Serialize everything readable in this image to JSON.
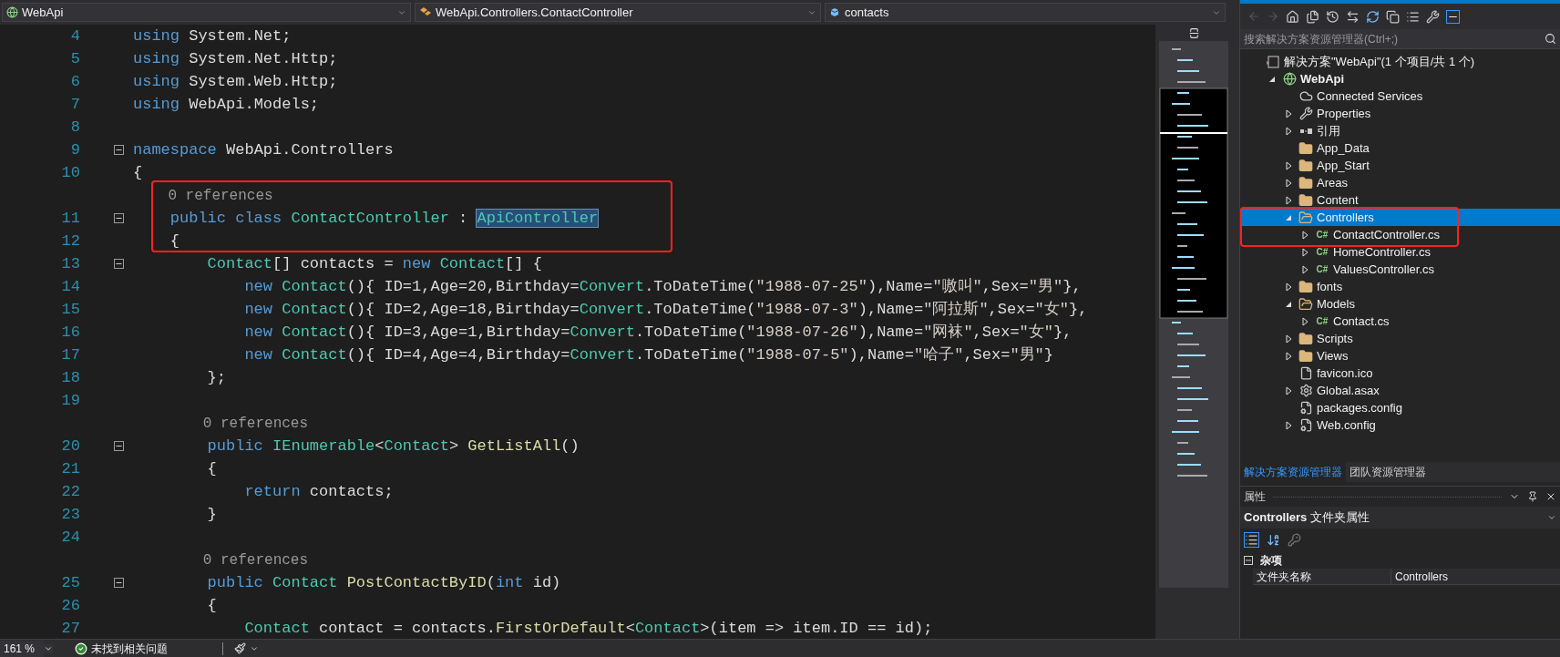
{
  "navbar": {
    "project": "WebApi",
    "type": "WebApi.Controllers.ContactController",
    "member": "contacts"
  },
  "code": [
    {
      "kind": "code",
      "number": "4",
      "fold": false,
      "tokens": [
        {
          "kind": "keyword",
          "text": "using"
        },
        {
          "kind": "plain",
          "text": " System.Net;"
        }
      ]
    },
    {
      "kind": "code",
      "number": "5",
      "fold": false,
      "tokens": [
        {
          "kind": "keyword",
          "text": "using"
        },
        {
          "kind": "plain",
          "text": " System.Net.Http;"
        }
      ]
    },
    {
      "kind": "code",
      "number": "6",
      "fold": false,
      "tokens": [
        {
          "kind": "keyword",
          "text": "using"
        },
        {
          "kind": "plain",
          "text": " System.Web.Http;"
        }
      ]
    },
    {
      "kind": "code",
      "number": "7",
      "fold": false,
      "tokens": [
        {
          "kind": "keyword",
          "text": "using"
        },
        {
          "kind": "plain",
          "text": " WebApi.Models;"
        }
      ]
    },
    {
      "kind": "code",
      "number": "8",
      "fold": false
    },
    {
      "kind": "code",
      "number": "9",
      "fold": true,
      "tokens": [
        {
          "kind": "keyword",
          "text": "namespace"
        },
        {
          "kind": "plain",
          "text": " WebApi.Controllers"
        }
      ]
    },
    {
      "kind": "code",
      "number": "10",
      "fold": false,
      "tokens": [
        {
          "kind": "plain",
          "text": "{"
        }
      ]
    },
    {
      "kind": "lens",
      "text": "    0 references"
    },
    {
      "kind": "code",
      "number": "11",
      "fold": true,
      "tokens": [
        {
          "kind": "keyword",
          "text": "    public class "
        },
        {
          "kind": "type",
          "text": "ContactController"
        },
        {
          "kind": "plain",
          "text": " : "
        },
        {
          "kind": "selected",
          "text": "ApiController"
        }
      ]
    },
    {
      "kind": "code",
      "number": "12",
      "fold": false,
      "tokens": [
        {
          "kind": "plain",
          "text": "    {"
        }
      ]
    },
    {
      "kind": "code",
      "number": "13",
      "fold": true,
      "tokens": [
        {
          "kind": "type",
          "text": "        Contact"
        },
        {
          "kind": "plain",
          "text": "[] contacts = "
        },
        {
          "kind": "keyword",
          "text": "new "
        },
        {
          "kind": "type",
          "text": "Contact"
        },
        {
          "kind": "plain",
          "text": "[] {"
        }
      ]
    },
    {
      "kind": "code",
      "number": "14",
      "fold": false,
      "tokens": [
        {
          "kind": "keyword",
          "text": "            new "
        },
        {
          "kind": "type",
          "text": "Contact"
        },
        {
          "kind": "plain",
          "text": "(){ ID=1,Age=20,Birthday="
        },
        {
          "kind": "type",
          "text": "Convert"
        },
        {
          "kind": "plain",
          "text": ".ToDateTime("
        },
        {
          "kind": "string",
          "text": "\"1988-07-25\""
        },
        {
          "kind": "plain",
          "text": "),Name="
        },
        {
          "kind": "string",
          "text": "\"嗷叫\""
        },
        {
          "kind": "plain",
          "text": ",Sex="
        },
        {
          "kind": "string",
          "text": "\"男\""
        },
        {
          "kind": "plain",
          "text": "},"
        }
      ]
    },
    {
      "kind": "code",
      "number": "15",
      "fold": false,
      "tokens": [
        {
          "kind": "keyword",
          "text": "            new "
        },
        {
          "kind": "type",
          "text": "Contact"
        },
        {
          "kind": "plain",
          "text": "(){ ID=2,Age=18,Birthday="
        },
        {
          "kind": "type",
          "text": "Convert"
        },
        {
          "kind": "plain",
          "text": ".ToDateTime("
        },
        {
          "kind": "string",
          "text": "\"1988-07-3\""
        },
        {
          "kind": "plain",
          "text": "),Name="
        },
        {
          "kind": "string",
          "text": "\"阿拉斯\""
        },
        {
          "kind": "plain",
          "text": ",Sex="
        },
        {
          "kind": "string",
          "text": "\"女\""
        },
        {
          "kind": "plain",
          "text": "},"
        }
      ]
    },
    {
      "kind": "code",
      "number": "16",
      "fold": false,
      "tokens": [
        {
          "kind": "keyword",
          "text": "            new "
        },
        {
          "kind": "type",
          "text": "Contact"
        },
        {
          "kind": "plain",
          "text": "(){ ID=3,Age=1,Birthday="
        },
        {
          "kind": "type",
          "text": "Convert"
        },
        {
          "kind": "plain",
          "text": ".ToDateTime("
        },
        {
          "kind": "string",
          "text": "\"1988-07-26\""
        },
        {
          "kind": "plain",
          "text": "),Name="
        },
        {
          "kind": "string",
          "text": "\"网袜\""
        },
        {
          "kind": "plain",
          "text": ",Sex="
        },
        {
          "kind": "string",
          "text": "\"女\""
        },
        {
          "kind": "plain",
          "text": "},"
        }
      ]
    },
    {
      "kind": "code",
      "number": "17",
      "fold": false,
      "tokens": [
        {
          "kind": "keyword",
          "text": "            new "
        },
        {
          "kind": "type",
          "text": "Contact"
        },
        {
          "kind": "plain",
          "text": "(){ ID=4,Age=4,Birthday="
        },
        {
          "kind": "type",
          "text": "Convert"
        },
        {
          "kind": "plain",
          "text": ".ToDateTime("
        },
        {
          "kind": "string",
          "text": "\"1988-07-5\""
        },
        {
          "kind": "plain",
          "text": "),Name="
        },
        {
          "kind": "string",
          "text": "\"哈子\""
        },
        {
          "kind": "plain",
          "text": ",Sex="
        },
        {
          "kind": "string",
          "text": "\"男\""
        },
        {
          "kind": "plain",
          "text": "}"
        }
      ]
    },
    {
      "kind": "code",
      "number": "18",
      "fold": false,
      "tokens": [
        {
          "kind": "plain",
          "text": "        };"
        }
      ]
    },
    {
      "kind": "code",
      "number": "19",
      "fold": false
    },
    {
      "kind": "lens",
      "text": "        0 references"
    },
    {
      "kind": "code",
      "number": "20",
      "fold": true,
      "tokens": [
        {
          "kind": "keyword",
          "text": "        public "
        },
        {
          "kind": "type",
          "text": "IEnumerable"
        },
        {
          "kind": "plain",
          "text": "<"
        },
        {
          "kind": "type",
          "text": "Contact"
        },
        {
          "kind": "plain",
          "text": "> "
        },
        {
          "kind": "method",
          "text": "GetListAll"
        },
        {
          "kind": "plain",
          "text": "()"
        }
      ]
    },
    {
      "kind": "code",
      "number": "21",
      "fold": false,
      "tokens": [
        {
          "kind": "plain",
          "text": "        {"
        }
      ]
    },
    {
      "kind": "code",
      "number": "22",
      "fold": false,
      "tokens": [
        {
          "kind": "keyword",
          "text": "            return"
        },
        {
          "kind": "plain",
          "text": " contacts;"
        }
      ]
    },
    {
      "kind": "code",
      "number": "23",
      "fold": false,
      "tokens": [
        {
          "kind": "plain",
          "text": "        }"
        }
      ]
    },
    {
      "kind": "code",
      "number": "24",
      "fold": false
    },
    {
      "kind": "lens",
      "text": "        0 references"
    },
    {
      "kind": "code",
      "number": "25",
      "fold": true,
      "tokens": [
        {
          "kind": "keyword",
          "text": "        public "
        },
        {
          "kind": "type",
          "text": "Contact "
        },
        {
          "kind": "method",
          "text": "PostContactByID"
        },
        {
          "kind": "plain",
          "text": "("
        },
        {
          "kind": "keyword",
          "text": "int"
        },
        {
          "kind": "plain",
          "text": " id)"
        }
      ]
    },
    {
      "kind": "code",
      "number": "26",
      "fold": false,
      "tokens": [
        {
          "kind": "plain",
          "text": "        {"
        }
      ]
    },
    {
      "kind": "code",
      "number": "27",
      "fold": false,
      "tokens": [
        {
          "kind": "type",
          "text": "            Contact"
        },
        {
          "kind": "plain",
          "text": " contact = contacts."
        },
        {
          "kind": "method",
          "text": "FirstOrDefault"
        },
        {
          "kind": "plain",
          "text": "<"
        },
        {
          "kind": "type",
          "text": "Contact"
        },
        {
          "kind": "plain",
          "text": ">(item => item.ID == id);"
        }
      ]
    }
  ],
  "solution_explorer": {
    "search": {
      "placeholder": "搜索解决方案资源管理器(Ctrl+;)"
    },
    "tree": [
      {
        "label": "解决方案\"WebApi\"(1 个项目/共 1 个)",
        "kind": "solution",
        "selected": false,
        "children": [
          {
            "label": "WebApi",
            "kind": "project",
            "expanded": true,
            "selected": false,
            "bold": true,
            "children": [
              {
                "label": "Connected Services",
                "kind": "cloud",
                "selected": false
              },
              {
                "label": "Properties",
                "kind": "wrench",
                "expanded": false,
                "selected": false
              },
              {
                "label": "引用",
                "kind": "references",
                "expanded": false,
                "selected": false
              },
              {
                "label": "App_Data",
                "kind": "folder",
                "selected": false
              },
              {
                "label": "App_Start",
                "kind": "folder",
                "expanded": false,
                "selected": false
              },
              {
                "label": "Areas",
                "kind": "folder",
                "expanded": false,
                "selected": false
              },
              {
                "label": "Content",
                "kind": "folder",
                "expanded": false,
                "selected": false
              },
              {
                "label": "Controllers",
                "kind": "folder-open",
                "expanded": true,
                "selected": true,
                "children": [
                  {
                    "label": "ContactController.cs",
                    "kind": "csharp",
                    "badge": "C#",
                    "expanded": false,
                    "selected": false
                  },
                  {
                    "label": "HomeController.cs",
                    "kind": "csharp",
                    "badge": "C#",
                    "expanded": false,
                    "selected": false
                  },
                  {
                    "label": "ValuesController.cs",
                    "kind": "csharp",
                    "badge": "C#",
                    "expanded": false,
                    "selected": false
                  }
                ]
              },
              {
                "label": "fonts",
                "kind": "folder",
                "expanded": false,
                "selected": false
              },
              {
                "label": "Models",
                "kind": "folder-open",
                "expanded": true,
                "selected": false,
                "children": [
                  {
                    "label": "Contact.cs",
                    "kind": "csharp",
                    "badge": "C#",
                    "expanded": false,
                    "selected": false
                  }
                ]
              },
              {
                "label": "Scripts",
                "kind": "folder",
                "expanded": false,
                "selected": false
              },
              {
                "label": "Views",
                "kind": "folder",
                "expanded": false,
                "selected": false
              },
              {
                "label": "favicon.ico",
                "kind": "file",
                "selected": false
              },
              {
                "label": "Global.asax",
                "kind": "gear-file",
                "expanded": false,
                "selected": false
              },
              {
                "label": "packages.config",
                "kind": "config",
                "selected": false
              },
              {
                "label": "Web.config",
                "kind": "config",
                "expanded": false,
                "selected": false
              }
            ]
          }
        ]
      }
    ]
  },
  "panel_tabs": [
    {
      "label": "解决方案资源管理器",
      "selected": true
    },
    {
      "label": "团队资源管理器",
      "selected": false
    }
  ],
  "properties": {
    "title": "属性",
    "object": "**Controllers** 文件夹属性",
    "category": {
      "label": "杂项",
      "expanded": true,
      "rows": [
        {
          "name": "文件夹名称",
          "value": "Controllers"
        }
      ]
    }
  },
  "status_bar": {
    "zoom": "161 %",
    "issues": "未找到相关问题"
  }
}
